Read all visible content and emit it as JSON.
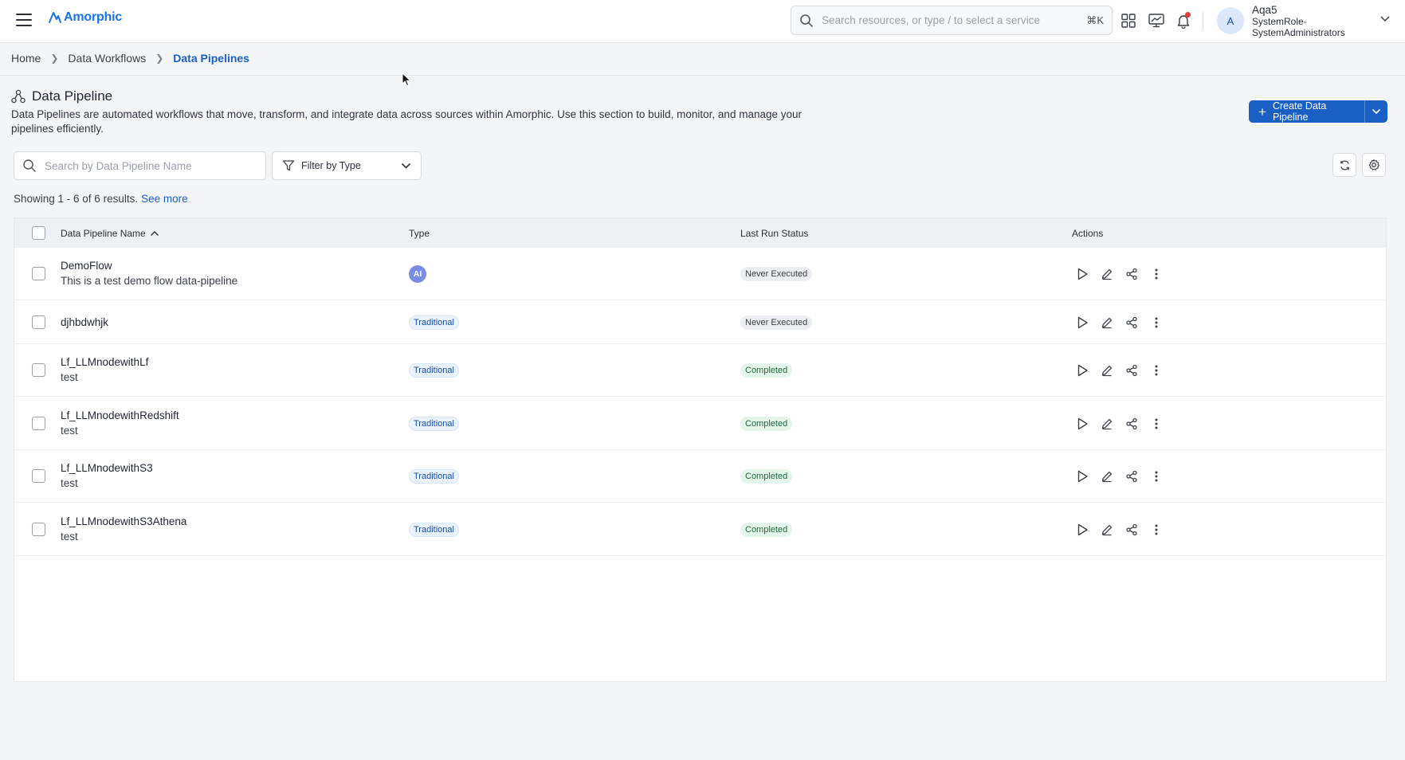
{
  "app": {
    "brand": "Amorphic"
  },
  "topbar": {
    "search_placeholder": "Search resources, or type / to select a service",
    "search_shortcut": "⌘K"
  },
  "user": {
    "avatar_initial": "A",
    "name": "Aqa5",
    "role_line1": "SystemRole-",
    "role_line2": "SystemAdministrators"
  },
  "breadcrumb": {
    "home": "Home",
    "workflows": "Data Workflows",
    "current": "Data Pipelines"
  },
  "header": {
    "title": "Data Pipeline",
    "description": "Data Pipelines are automated workflows that move, transform, and integrate data across sources within Amorphic. Use this section to build, monitor, and manage your pipelines efficiently.",
    "create_label": "Create Data Pipeline"
  },
  "filters": {
    "search_placeholder": "Search by Data Pipeline Name",
    "type_label": "Filter by Type"
  },
  "results": {
    "text": "Showing 1 - 6 of 6 results.",
    "see_more": "See more"
  },
  "table": {
    "columns": {
      "name": "Data Pipeline Name",
      "type": "Type",
      "status": "Last Run Status",
      "actions": "Actions"
    },
    "rows": [
      {
        "name": "DemoFlow",
        "desc": "This is a test demo flow data-pipeline",
        "type": "AI",
        "status": "Never Executed",
        "status_kind": "never"
      },
      {
        "name": "djhbdwhjk",
        "desc": "",
        "type": "Traditional",
        "status": "Never Executed",
        "status_kind": "never"
      },
      {
        "name": "Lf_LLMnodewithLf",
        "desc": "test",
        "type": "Traditional",
        "status": "Completed",
        "status_kind": "completed"
      },
      {
        "name": "Lf_LLMnodewithRedshift",
        "desc": "test",
        "type": "Traditional",
        "status": "Completed",
        "status_kind": "completed"
      },
      {
        "name": "Lf_LLMnodewithS3",
        "desc": "test",
        "type": "Traditional",
        "status": "Completed",
        "status_kind": "completed"
      },
      {
        "name": "Lf_LLMnodewithS3Athena",
        "desc": "test",
        "type": "Traditional",
        "status": "Completed",
        "status_kind": "completed"
      }
    ]
  },
  "colors": {
    "accent": "#1a5fc4",
    "completed_bg": "#e4f5ea",
    "never_bg": "#eceef1"
  }
}
